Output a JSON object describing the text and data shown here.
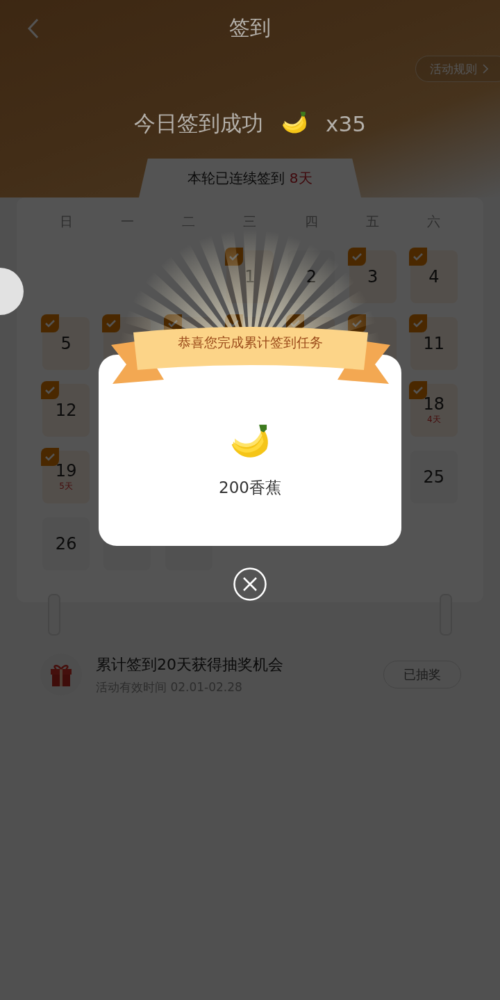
{
  "header": {
    "title": "签到"
  },
  "rules_button": {
    "label": "活动规则"
  },
  "today": {
    "message": "今日签到成功",
    "reward": "x35"
  },
  "streak": {
    "text": "本轮已连续签到",
    "days": "8天"
  },
  "calendar": {
    "weekdays": [
      "日",
      "一",
      "二",
      "三",
      "四",
      "五",
      "六"
    ],
    "cells": [
      {
        "kind": "empty"
      },
      {
        "kind": "empty"
      },
      {
        "kind": "empty"
      },
      {
        "kind": "day",
        "day": "1",
        "checked": true
      },
      {
        "kind": "day",
        "day": "2",
        "checked": false
      },
      {
        "kind": "day",
        "day": "3",
        "checked": true
      },
      {
        "kind": "day",
        "day": "4",
        "checked": true
      },
      {
        "kind": "day",
        "day": "5",
        "checked": true
      },
      {
        "kind": "covered",
        "checked": true
      },
      {
        "kind": "covered",
        "checked": true
      },
      {
        "kind": "covered",
        "checked": true
      },
      {
        "kind": "covered",
        "checked": true
      },
      {
        "kind": "covered",
        "checked": true
      },
      {
        "kind": "day",
        "day": "11",
        "checked": true
      },
      {
        "kind": "day",
        "day": "12",
        "checked": true
      },
      {
        "kind": "covered"
      },
      {
        "kind": "covered"
      },
      {
        "kind": "covered"
      },
      {
        "kind": "covered"
      },
      {
        "kind": "covered"
      },
      {
        "kind": "day",
        "day": "18",
        "checked": true,
        "note": "4天"
      },
      {
        "kind": "day",
        "day": "19",
        "checked": true,
        "note": "5天"
      },
      {
        "kind": "covered"
      },
      {
        "kind": "covered"
      },
      {
        "kind": "covered"
      },
      {
        "kind": "covered"
      },
      {
        "kind": "covered"
      },
      {
        "kind": "day",
        "day": "25",
        "checked": false
      },
      {
        "kind": "day",
        "day": "26",
        "checked": false
      },
      {
        "kind": "covered"
      },
      {
        "kind": "covered"
      }
    ]
  },
  "task": {
    "title": "累计签到20天获得抽奖机会",
    "period": "活动有效时间 02.01-02.28",
    "button": {
      "label": "已抽奖"
    }
  },
  "modal": {
    "banner": "恭喜您完成累计签到任务",
    "reward": "200香蕉"
  }
}
